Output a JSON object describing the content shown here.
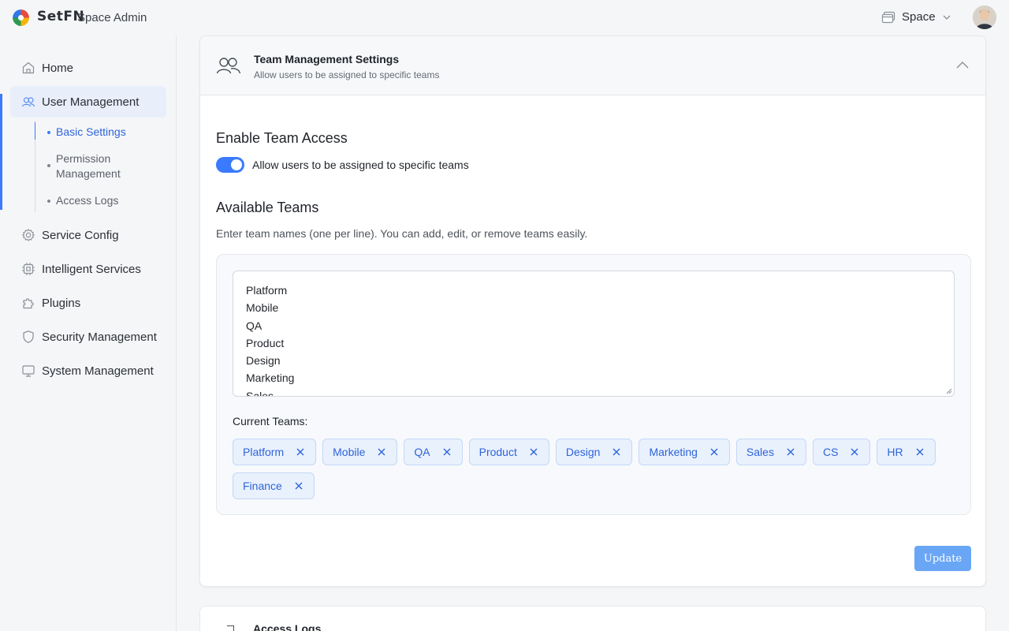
{
  "header": {
    "logo_text": "SetFN",
    "logo_sub": "Space Admin",
    "space_label": "Space"
  },
  "sidebar": {
    "items": [
      {
        "label": "Home",
        "icon": "home-icon"
      },
      {
        "label": "User Management",
        "icon": "users-icon"
      },
      {
        "label": "Service Config",
        "icon": "gear-icon"
      },
      {
        "label": "Intelligent Services",
        "icon": "chip-icon"
      },
      {
        "label": "Plugins",
        "icon": "puzzle-icon"
      },
      {
        "label": "Security Management",
        "icon": "shield-icon"
      },
      {
        "label": "System Management",
        "icon": "monitor-icon"
      }
    ],
    "sub_items": [
      "Basic Settings",
      "Permission Management",
      "Access Logs"
    ]
  },
  "card": {
    "title": "Team Management Settings",
    "subtitle": "Allow users to be assigned to specific teams",
    "enable_title": "Enable Team Access",
    "toggle_label": "Allow users to be assigned to specific teams",
    "toggle_on": true,
    "teams_title": "Available Teams",
    "teams_help": "Enter team names (one per line). You can add, edit, or remove teams easily.",
    "textarea_lines": [
      "Platform",
      "Mobile",
      "QA",
      "Product",
      "Design",
      "Marketing",
      "Sales"
    ],
    "current_label": "Current Teams:",
    "teams": [
      "Platform",
      "Mobile",
      "QA",
      "Product",
      "Design",
      "Marketing",
      "Sales",
      "CS",
      "HR",
      "Finance"
    ],
    "update_label": "Update"
  },
  "card2": {
    "title": "Access Logs"
  },
  "colors": {
    "accent": "#3a7afe",
    "tag_bg": "#e9f1fd",
    "tag_text": "#2e64d8",
    "button": "#6aa6f6"
  }
}
